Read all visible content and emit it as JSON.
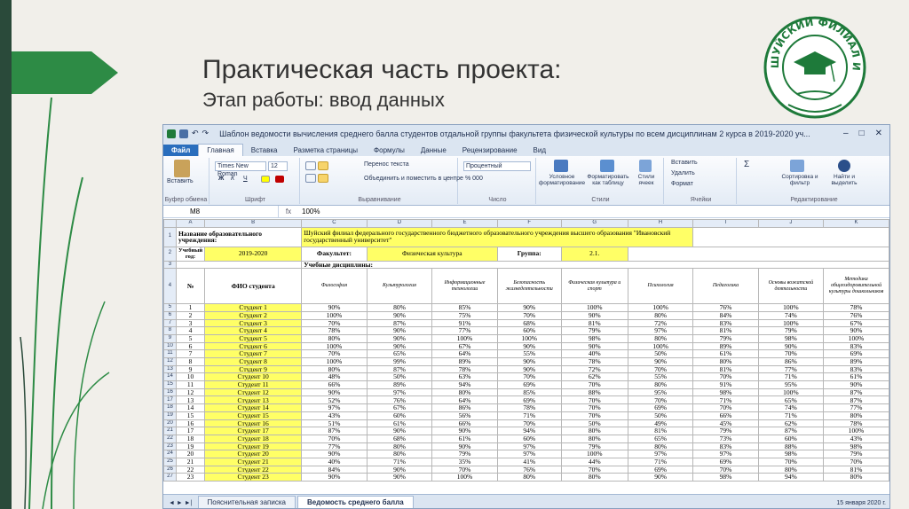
{
  "slide": {
    "title": "Практическая часть проекта:",
    "subtitle": "Этап работы: ввод данных",
    "logo_text": "ШУЙСКИЙ ФИЛИАЛ ИВГУ",
    "colors": {
      "accent": "#2d8b45",
      "dark": "#2a4a3a",
      "logo": "#1e7a3a"
    }
  },
  "excel": {
    "window_title": "Шаблон ведомости вычисления среднего балла студентов отдальной группы факультета физической культуры по всем дисциплинам 2 курса в 2019-2020 уч...",
    "window_buttons": [
      "–",
      "□",
      "✕"
    ],
    "tabs": [
      "Файл",
      "Главная",
      "Вставка",
      "Разметка страницы",
      "Формулы",
      "Данные",
      "Рецензирование",
      "Вид"
    ],
    "ribbon": {
      "paste": "Вставить",
      "clipboard": "Буфер обмена",
      "font_name": "Times New Roman",
      "font_size": "12",
      "font_group": "Шрифт",
      "bold": "Ж",
      "italic": "К",
      "underline": "Ч",
      "wrap_text": "Перенос текста",
      "merge": "Объединить и поместить в центре",
      "align_group": "Выравнивание",
      "number_format": "Процентный",
      "number_group": "Число",
      "cond_format": "Условное форматирование",
      "format_table": "Форматировать как таблицу",
      "cell_styles": "Стили ячеек",
      "styles_group": "Стили",
      "insert": "Вставить",
      "delete": "Удалить",
      "format": "Формат",
      "cells_group": "Ячейки",
      "sort": "Сортировка и фильтр",
      "find": "Найти и выделить",
      "edit_group": "Редактирование"
    },
    "name_box": "M8",
    "fx": "fx",
    "formula": "100%",
    "columns": [
      "A",
      "B",
      "C",
      "D",
      "E",
      "F",
      "G",
      "H",
      "I",
      "J",
      "K"
    ],
    "row1_label": "Название образовательного учреждения:",
    "row1_value": "Шуйский филиал федерального государственного бюджетного образовательного учреждения высшего образования \"Ивановский государственный университет\"",
    "row2": {
      "year_label": "Учебный год:",
      "year": "2019-2020",
      "fac_label": "Факультет:",
      "fac": "Физическая культура",
      "grp_label": "Группа:",
      "grp": "2.1."
    },
    "row3_label": "Учебные дисциплины:",
    "header": [
      "№",
      "ФИО студента",
      "Философия",
      "Культурология",
      "Информационные технологии",
      "Безопасность жизнедеятельности",
      "Физическая культура и спорт",
      "Психология",
      "Педагогика",
      "Основы вожатской деятельности",
      "Методика общеоздоровительной культуры дошкольников"
    ],
    "rows": [
      {
        "r": "5",
        "n": "1",
        "name": "Студент 1",
        "v": [
          "90%",
          "80%",
          "85%",
          "90%",
          "100%",
          "100%",
          "76%",
          "100%",
          "78%"
        ]
      },
      {
        "r": "6",
        "n": "2",
        "name": "Студент 2",
        "v": [
          "100%",
          "90%",
          "75%",
          "70%",
          "90%",
          "80%",
          "84%",
          "74%",
          "76%"
        ]
      },
      {
        "r": "7",
        "n": "3",
        "name": "Студент 3",
        "v": [
          "70%",
          "87%",
          "91%",
          "68%",
          "81%",
          "72%",
          "83%",
          "100%",
          "67%"
        ]
      },
      {
        "r": "8",
        "n": "4",
        "name": "Студент 4",
        "v": [
          "78%",
          "90%",
          "77%",
          "60%",
          "79%",
          "97%",
          "81%",
          "79%",
          "90%"
        ]
      },
      {
        "r": "9",
        "n": "5",
        "name": "Студент 5",
        "v": [
          "80%",
          "90%",
          "100%",
          "100%",
          "98%",
          "80%",
          "79%",
          "98%",
          "100%"
        ]
      },
      {
        "r": "10",
        "n": "6",
        "name": "Студент 6",
        "v": [
          "100%",
          "90%",
          "67%",
          "90%",
          "90%",
          "100%",
          "89%",
          "90%",
          "83%"
        ]
      },
      {
        "r": "11",
        "n": "7",
        "name": "Студент 7",
        "v": [
          "70%",
          "65%",
          "64%",
          "55%",
          "40%",
          "50%",
          "61%",
          "70%",
          "69%"
        ]
      },
      {
        "r": "12",
        "n": "8",
        "name": "Студент 8",
        "v": [
          "100%",
          "99%",
          "89%",
          "90%",
          "78%",
          "90%",
          "80%",
          "86%",
          "89%"
        ]
      },
      {
        "r": "13",
        "n": "9",
        "name": "Студент 9",
        "v": [
          "80%",
          "87%",
          "78%",
          "90%",
          "72%",
          "70%",
          "81%",
          "77%",
          "83%"
        ]
      },
      {
        "r": "14",
        "n": "10",
        "name": "Студент 10",
        "v": [
          "48%",
          "50%",
          "63%",
          "70%",
          "62%",
          "55%",
          "70%",
          "71%",
          "61%"
        ]
      },
      {
        "r": "15",
        "n": "11",
        "name": "Студент 11",
        "v": [
          "66%",
          "89%",
          "94%",
          "69%",
          "70%",
          "80%",
          "91%",
          "95%",
          "90%"
        ]
      },
      {
        "r": "16",
        "n": "12",
        "name": "Студент 12",
        "v": [
          "90%",
          "97%",
          "80%",
          "85%",
          "88%",
          "95%",
          "98%",
          "100%",
          "87%"
        ]
      },
      {
        "r": "17",
        "n": "13",
        "name": "Студент 13",
        "v": [
          "52%",
          "76%",
          "64%",
          "69%",
          "70%",
          "70%",
          "71%",
          "65%",
          "87%"
        ]
      },
      {
        "r": "18",
        "n": "14",
        "name": "Студент 14",
        "v": [
          "97%",
          "67%",
          "86%",
          "78%",
          "70%",
          "69%",
          "70%",
          "74%",
          "77%"
        ]
      },
      {
        "r": "19",
        "n": "15",
        "name": "Студент 15",
        "v": [
          "43%",
          "60%",
          "56%",
          "71%",
          "70%",
          "50%",
          "66%",
          "71%",
          "80%"
        ]
      },
      {
        "r": "20",
        "n": "16",
        "name": "Студент 16",
        "v": [
          "51%",
          "61%",
          "66%",
          "70%",
          "50%",
          "49%",
          "45%",
          "62%",
          "78%"
        ]
      },
      {
        "r": "21",
        "n": "17",
        "name": "Студент 17",
        "v": [
          "87%",
          "90%",
          "90%",
          "94%",
          "80%",
          "81%",
          "79%",
          "87%",
          "100%"
        ]
      },
      {
        "r": "22",
        "n": "18",
        "name": "Студент 18",
        "v": [
          "70%",
          "68%",
          "61%",
          "60%",
          "80%",
          "65%",
          "73%",
          "60%",
          "43%"
        ]
      },
      {
        "r": "23",
        "n": "19",
        "name": "Студент 19",
        "v": [
          "77%",
          "80%",
          "90%",
          "97%",
          "79%",
          "80%",
          "83%",
          "88%",
          "98%"
        ]
      },
      {
        "r": "24",
        "n": "20",
        "name": "Студент 20",
        "v": [
          "90%",
          "80%",
          "79%",
          "97%",
          "100%",
          "97%",
          "97%",
          "98%",
          "79%"
        ]
      },
      {
        "r": "25",
        "n": "21",
        "name": "Студент 21",
        "v": [
          "40%",
          "71%",
          "35%",
          "41%",
          "44%",
          "71%",
          "69%",
          "70%",
          "70%"
        ]
      },
      {
        "r": "26",
        "n": "22",
        "name": "Студент 22",
        "v": [
          "84%",
          "90%",
          "70%",
          "76%",
          "70%",
          "69%",
          "70%",
          "80%",
          "81%"
        ]
      },
      {
        "r": "27",
        "n": "23",
        "name": "Студент 23",
        "v": [
          "90%",
          "90%",
          "100%",
          "80%",
          "80%",
          "90%",
          "98%",
          "94%",
          "80%"
        ]
      }
    ],
    "sheet_tabs": [
      "Пояснительная записка",
      "Ведомость среднего балла"
    ],
    "sheet_nav": "◄ ► ►|",
    "clock": "15 января 2020 г."
  }
}
